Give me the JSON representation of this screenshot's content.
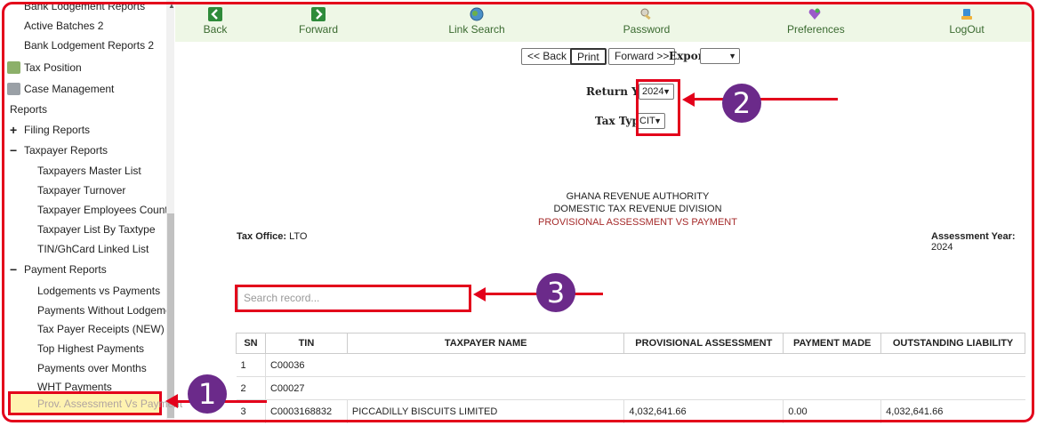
{
  "sidebar": {
    "items": [
      {
        "label": "Bank Lodgement Reports"
      },
      {
        "label": "Active Batches 2"
      },
      {
        "label": "Bank Lodgement Reports 2"
      },
      {
        "label": "Tax Position"
      },
      {
        "label": "Case Management"
      },
      {
        "label": "Reports"
      },
      {
        "label": "Filing Reports"
      },
      {
        "label": "Taxpayer Reports"
      },
      {
        "label": "Taxpayers Master List"
      },
      {
        "label": "Taxpayer Turnover"
      },
      {
        "label": "Taxpayer Employees Count"
      },
      {
        "label": "Taxpayer List By Taxtype"
      },
      {
        "label": "TIN/GhCard Linked List"
      },
      {
        "label": "Payment Reports"
      },
      {
        "label": "Lodgements vs Payments"
      },
      {
        "label": "Payments Without Lodgement"
      },
      {
        "label": "Tax Payer Receipts (NEW)"
      },
      {
        "label": "Top Highest Payments"
      },
      {
        "label": "Payments over Months"
      },
      {
        "label": "WHT Payments"
      },
      {
        "label": "Prov. Assessment Vs Payment"
      }
    ],
    "expand_sign": "+",
    "collapse_sign": "−"
  },
  "nav": {
    "back": "Back",
    "forward": "Forward",
    "link_search": "Link Search",
    "password": "Password",
    "preferences": "Preferences",
    "logout": "LogOut"
  },
  "toolbar": {
    "back": "<< Back",
    "print": "Print",
    "forward": "Forward >>",
    "export": "Export"
  },
  "filters": {
    "return_year_label": "Return Year",
    "return_year_value": "2024",
    "tax_type_label": "Tax Type",
    "tax_type_value": "CIT"
  },
  "report": {
    "line1": "GHANA REVENUE AUTHORITY",
    "line2": "DOMESTIC TAX REVENUE DIVISION",
    "line3": "PROVISIONAL ASSESSMENT VS PAYMENT",
    "tax_office_label": "Tax Office:",
    "tax_office_value": "LTO",
    "assessment_year_label": "Assessment Year:",
    "assessment_year_value": "2024"
  },
  "search": {
    "placeholder": "Search record..."
  },
  "table": {
    "headers": [
      "SN",
      "TIN",
      "TAXPAYER NAME",
      "PROVISIONAL ASSESSMENT",
      "PAYMENT MADE",
      "OUTSTANDING LIABILITY"
    ],
    "rows": [
      [
        "1",
        "C00036",
        "",
        "",
        "",
        ""
      ],
      [
        "2",
        "C00027",
        "",
        "",
        "",
        ""
      ],
      [
        "3",
        "C0003168832",
        "PICCADILLY BISCUITS LIMITED",
        "4,032,641.66",
        "0.00",
        "4,032,641.66"
      ]
    ]
  },
  "annotations": {
    "one": "1",
    "two": "2",
    "three": "3"
  },
  "colors": {
    "accent_red": "#e3001b",
    "badge_purple": "#6b2a8a",
    "nav_green": "#3a6a30"
  }
}
